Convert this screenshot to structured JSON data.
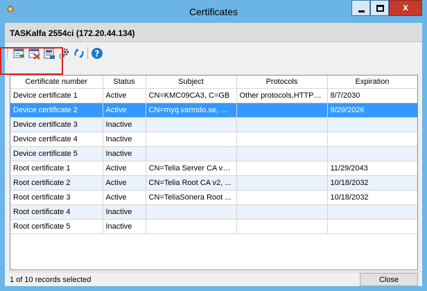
{
  "window": {
    "title": "Certificates",
    "minimize_label": "_",
    "maximize_label": "□",
    "close_label": "x"
  },
  "device": {
    "title": "TASKalfa 2554ci (172.20.44.134)"
  },
  "toolbar": {
    "icons": [
      "import-certificate-icon",
      "delete-certificate-icon",
      "export-certificate-icon",
      "certificate-settings-icon",
      "refresh-icon",
      "help-icon"
    ]
  },
  "table": {
    "columns": [
      "Certificate number",
      "Status",
      "Subject",
      "Protocols",
      "Expiration"
    ],
    "rows": [
      {
        "number": "Device certificate 1",
        "status": "Active",
        "subject": "CN=KMC09CA3, C=GB",
        "protocols": "Other protocols,HTTPS...",
        "expiration": "8/7/2030"
      },
      {
        "number": "Device certificate 2",
        "status": "Active",
        "subject": "CN=myq.varmdo.se, O=...",
        "protocols": "",
        "expiration": "9/29/2026"
      },
      {
        "number": "Device certificate 3",
        "status": "Inactive",
        "subject": "",
        "protocols": "",
        "expiration": ""
      },
      {
        "number": "Device certificate 4",
        "status": "Inactive",
        "subject": "",
        "protocols": "",
        "expiration": ""
      },
      {
        "number": "Device certificate 5",
        "status": "Inactive",
        "subject": "",
        "protocols": "",
        "expiration": ""
      },
      {
        "number": "Root certificate 1",
        "status": "Active",
        "subject": "CN=Telia Server CA v3,...",
        "protocols": "",
        "expiration": "11/29/2043"
      },
      {
        "number": "Root certificate 2",
        "status": "Active",
        "subject": "CN=Telia Root CA v2, ...",
        "protocols": "",
        "expiration": "10/18/2032"
      },
      {
        "number": "Root certificate 3",
        "status": "Active",
        "subject": "CN=TeliaSonera Root ...",
        "protocols": "",
        "expiration": "10/18/2032"
      },
      {
        "number": "Root certificate 4",
        "status": "Inactive",
        "subject": "",
        "protocols": "",
        "expiration": ""
      },
      {
        "number": "Root certificate 5",
        "status": "Inactive",
        "subject": "",
        "protocols": "",
        "expiration": ""
      }
    ],
    "selected_row": 1
  },
  "status": {
    "text": "1 of 10 records selected",
    "close_button": "Close"
  },
  "colors": {
    "titlebar": "#6ab4e6",
    "selection": "#3399ff",
    "alt_row": "#eaf2fb",
    "highlight_box": "#e02020"
  }
}
